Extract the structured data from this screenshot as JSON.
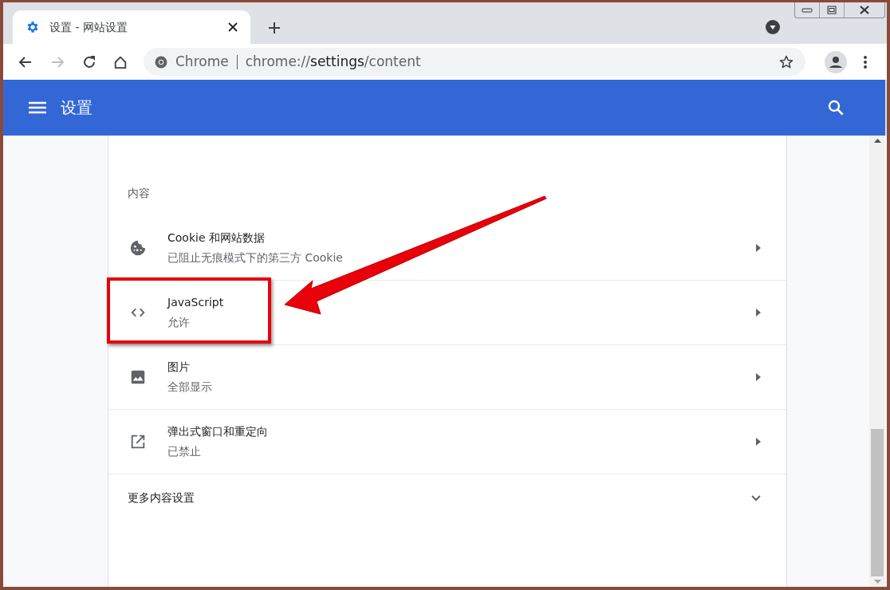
{
  "tab": {
    "title": "设置 - 网站设置",
    "selected": true
  },
  "address": {
    "origin": "Chrome",
    "scheme": "chrome://",
    "host": "settings",
    "path": "/content"
  },
  "header": {
    "title": "设置"
  },
  "section": {
    "title": "内容",
    "items": [
      {
        "kind": "cookie",
        "title": "Cookie 和网站数据",
        "subtitle": "已阻止无痕模式下的第三方 Cookie"
      },
      {
        "kind": "code",
        "title": "JavaScript",
        "subtitle": "允许"
      },
      {
        "kind": "image",
        "title": "图片",
        "subtitle": "全部显示"
      },
      {
        "kind": "popup",
        "title": "弹出式窗口和重定向",
        "subtitle": "已禁止"
      }
    ],
    "more": {
      "label": "更多内容设置",
      "expanded": false
    }
  }
}
